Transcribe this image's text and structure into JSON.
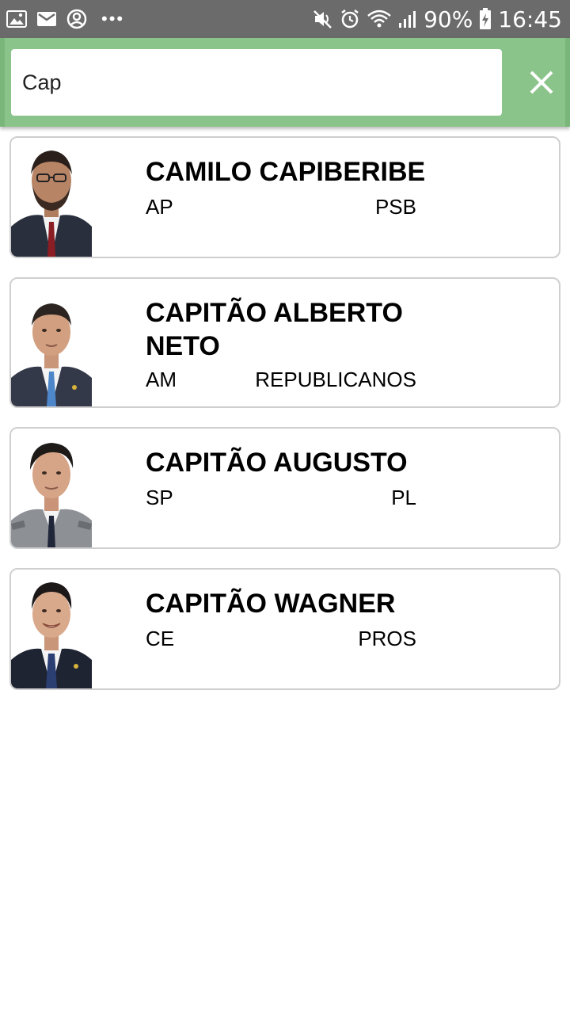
{
  "status_bar": {
    "left_icons": [
      "image-icon",
      "gmail-icon",
      "account-circle-icon",
      "more-dots-icon"
    ],
    "right_icons": [
      "mute-icon",
      "alarm-icon",
      "wifi-icon",
      "signal-icon",
      "battery-charging-icon"
    ],
    "battery": "90%",
    "time": "16:45"
  },
  "search": {
    "value": "Cap",
    "close_icon": "close-icon"
  },
  "colors": {
    "header_green": "#8bc48a",
    "status_gray": "#6b6b6b",
    "card_border": "#cfcfcf"
  },
  "results": [
    {
      "name": "CAMILO CAPIBERIBE",
      "state": "AP",
      "party": "PSB"
    },
    {
      "name": "CAPITÃO ALBERTO NETO",
      "state": "AM",
      "party": "REPUBLICANOS"
    },
    {
      "name": "CAPITÃO AUGUSTO",
      "state": "SP",
      "party": "PL"
    },
    {
      "name": "CAPITÃO WAGNER",
      "state": "CE",
      "party": "PROS"
    }
  ]
}
